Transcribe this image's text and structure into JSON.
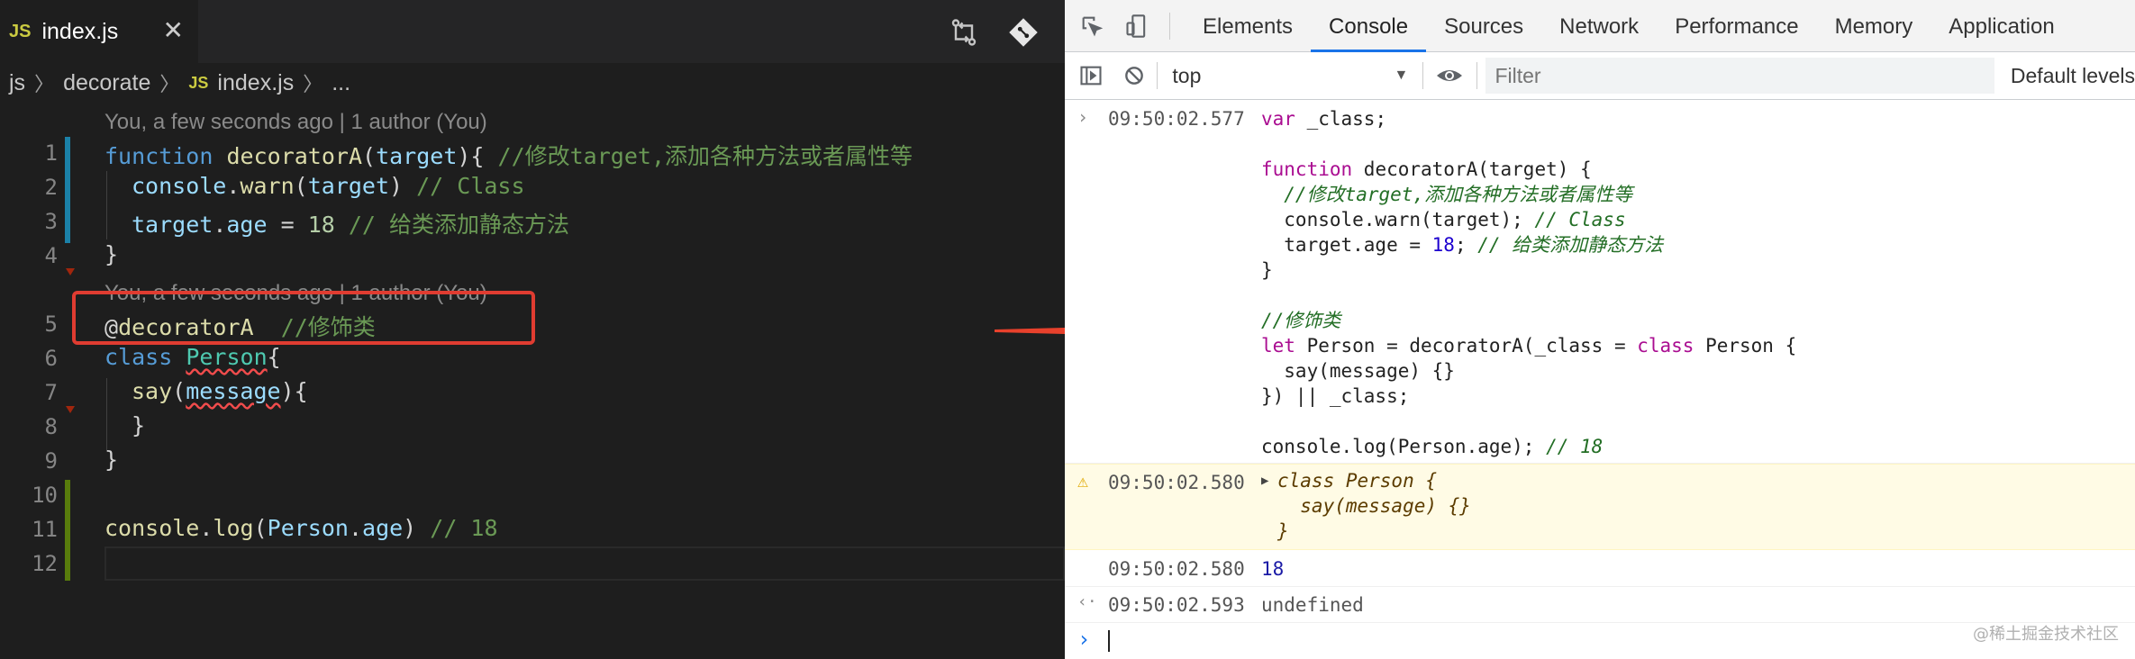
{
  "editor": {
    "tab": {
      "badge": "JS",
      "title": "index.js",
      "close": "✕"
    },
    "breadcrumb": {
      "folder1": "js",
      "folder2": "decorate",
      "badge": "JS",
      "file": "index.js",
      "more": "..."
    },
    "blame_1": "You, a few seconds ago | 1 author (You)",
    "blame_2": "You, a few seconds ago | 1 author (You)",
    "line_numbers": [
      "1",
      "2",
      "3",
      "4",
      "5",
      "6",
      "7",
      "8",
      "9",
      "10",
      "11",
      "12"
    ],
    "lines": {
      "l1": {
        "kw": "function",
        "fn": "decoratorA",
        "p1": "(",
        "vr": "target",
        "p2": "){ ",
        "cm": "//修改target,添加各种方法或者属性等"
      },
      "l2": {
        "vr1": "console",
        "p1": ".",
        "fn": "warn",
        "p2": "(",
        "vr2": "target",
        "p3": ") ",
        "cm": "// Class"
      },
      "l3": {
        "vr1": "target",
        "p1": ".",
        "vr2": "age",
        "p2": " = ",
        "nm": "18",
        "p3": " ",
        "cm": "// 给类添加静态方法"
      },
      "l4": {
        "p": "}"
      },
      "l5": {
        "p1": "@",
        "fn": "decoratorA",
        "p2": "  ",
        "cm": "//修饰类"
      },
      "l6": {
        "kw": "class",
        "p1": " ",
        "cls": "Person",
        "p2": "{"
      },
      "l7": {
        "fn": "say",
        "p1": "(",
        "vr": "message",
        "p2": "){"
      },
      "l8": {
        "p": "}"
      },
      "l9": {
        "p": "}"
      },
      "l11": {
        "vr1": "console",
        "p1": ".",
        "fn": "log",
        "p2": "(",
        "vr2": "Person",
        "p3": ".",
        "vr3": "age",
        "p4": ") ",
        "cm": "// 18"
      }
    }
  },
  "devtools": {
    "tabs": [
      "Elements",
      "Console",
      "Sources",
      "Network",
      "Performance",
      "Memory",
      "Application"
    ],
    "active_tab": "Console",
    "context": "top",
    "filter_placeholder": "Filter",
    "levels": "Default levels",
    "entries": {
      "e1": {
        "glyph": "›",
        "time": "09:50:02.577",
        "code": {
          "c1a": "var",
          "c1b": " _class;",
          "c3a": "function",
          "c3b": " decoratorA(target) {",
          "c4": "  //修改target,添加各种方法或者属性等",
          "c5a": "  console.warn(target); ",
          "c5b": "// Class",
          "c6a": "  target.age = ",
          "c6b": "18",
          "c6c": "; ",
          "c6d": "// 给类添加静态方法",
          "c7": "}",
          "c9": "//修饰类",
          "c10a": "let",
          "c10b": " Person = decoratorA(_class = ",
          "c10c": "class",
          "c10d": " Person {",
          "c11": "  say(message) {}",
          "c12": "}) || _class;",
          "c14a": "console.log(Person.age); ",
          "c14b": "// 18"
        }
      },
      "e2": {
        "glyph": "⚠",
        "time": "09:50:02.580",
        "caret": "▶",
        "l1": "class Person {",
        "l2": "  say(message) {}",
        "l3": "}"
      },
      "e3": {
        "time": "09:50:02.580",
        "value": "18"
      },
      "e4": {
        "glyph": "‹·",
        "time": "09:50:02.593",
        "value": "undefined"
      },
      "prompt": "›"
    },
    "watermark": "@稀土掘金技术社区"
  },
  "colors": {
    "editor_bg": "#1e1e1e",
    "highlight_box": "#e03c31",
    "arrow": "#e8412c",
    "active_tab_underline": "#1a73e8",
    "warning_bg": "#fffbe5"
  },
  "icons": [
    "source-control-compare-icon",
    "git-commit-icon",
    "inspect-element-icon",
    "device-toggle-icon",
    "sidebar-toggle-icon",
    "clear-console-icon",
    "eye-icon"
  ]
}
